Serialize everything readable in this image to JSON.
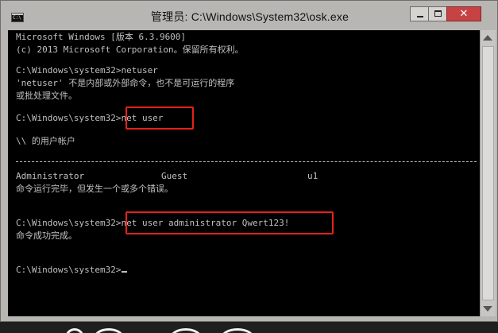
{
  "window": {
    "title": "管理员: C:\\Windows\\System32\\osk.exe",
    "icon": "console-app-icon",
    "controls": {
      "minimize": "minimize",
      "maximize": "maximize",
      "close": "✕"
    }
  },
  "console": {
    "lines": [
      {
        "text": "Microsoft Windows [版本 6.3.9600]",
        "row": 0
      },
      {
        "text": "(c) 2013 Microsoft Corporation。保留所有权利。",
        "row": 1
      },
      {
        "text": "C:\\Windows\\system32>netuser",
        "row": 3
      },
      {
        "text": "'netuser' 不是内部或外部命令，也不是可运行的程序",
        "row": 4
      },
      {
        "text": "或批处理文件。",
        "row": 5
      },
      {
        "text": "C:\\Windows\\system32>net user",
        "row": 7
      },
      {
        "text": "\\\\ 的用户帐户",
        "row": 9
      },
      {
        "text": "命令运行完毕，但发生一个或多个错误。",
        "row": 12
      },
      {
        "text": "C:\\Windows\\system32>net user administrator Qwert123!",
        "row": 15
      },
      {
        "text": "命令成功完成。",
        "row": 16
      },
      {
        "text": "C:\\Windows\\system32>",
        "row": 18
      }
    ],
    "separator": "-------------------------------------------------------------------------------",
    "user_accounts": [
      "Administrator",
      "Guest",
      "u1"
    ],
    "highlighted_commands": [
      "net user",
      "net user administrator Qwert123!"
    ]
  },
  "colors": {
    "console_bg": "#000000",
    "console_fg": "#c0c0c0",
    "highlight": "#e8201c",
    "titlebar": "#b8b6b3",
    "close_button": "#c74343"
  }
}
